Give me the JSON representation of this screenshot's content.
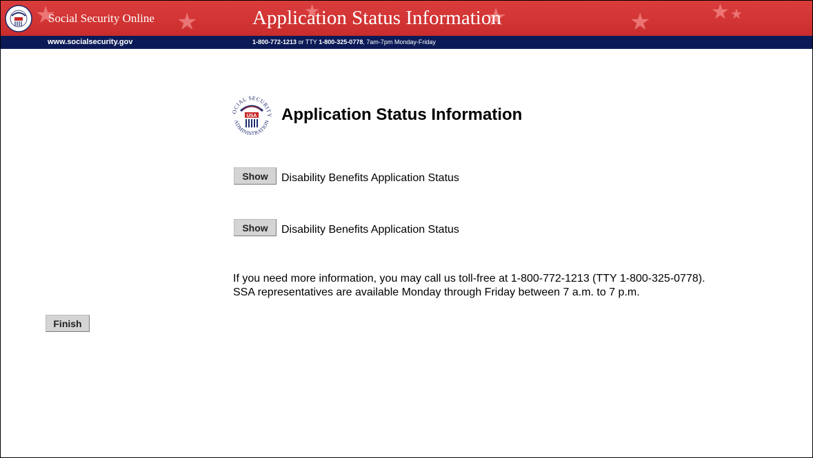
{
  "header": {
    "site_name": "Social Security Online",
    "title": "Application Status Information",
    "url": "www.socialsecurity.gov",
    "phone_primary": "1-800-772-1213",
    "phone_connector": "or TTY",
    "phone_tty": "1-800-325-0778",
    "hours": ", 7am-7pm Monday-Friday",
    "colors": {
      "banner_red": "#d23434",
      "banner_navy": "#0b1a57"
    }
  },
  "logo": {
    "icon": "ssa-seal-icon",
    "text_top": "SOCIAL SECURITY",
    "text_bottom": "ADMINISTRATION",
    "text_center": "USA"
  },
  "main": {
    "title": "Application Status Information",
    "rows": [
      {
        "button_label": "Show",
        "label": "Disability Benefits Application Status"
      },
      {
        "button_label": "Show",
        "label": "Disability Benefits Application Status"
      }
    ],
    "info": "If you need more information, you may call us toll-free at 1-800-772-1213 (TTY 1-800-325-0778). SSA representatives are available Monday through Friday between 7 a.m. to 7 p.m.",
    "finish_label": "Finish"
  }
}
